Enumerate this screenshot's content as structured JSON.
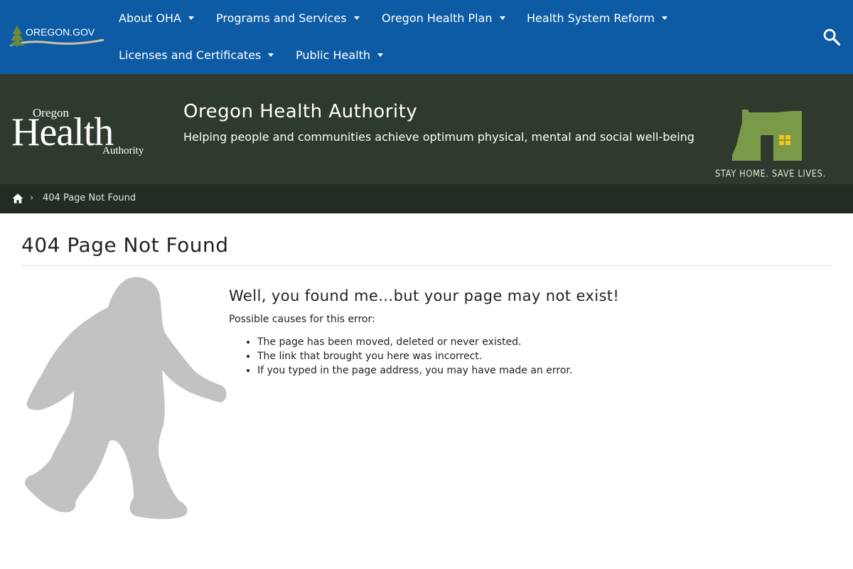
{
  "topnav": {
    "gov_logo_text": "OREGON.GOV",
    "items": [
      {
        "label": "About OHA"
      },
      {
        "label": "Programs and Services"
      },
      {
        "label": "Oregon Health Plan"
      },
      {
        "label": "Health System Reform"
      },
      {
        "label": "Licenses and Certificates"
      },
      {
        "label": "Public Health"
      }
    ],
    "search_icon": "search-icon"
  },
  "banner": {
    "logo_text_small_top": "Oregon",
    "logo_text_big": "Health",
    "logo_text_small_bottom": "Authority",
    "title": "Oregon Health Authority",
    "tagline": "Helping people and communities achieve optimum physical, mental and social well-being",
    "campaign_text": "STAY HOME. SAVE LIVES."
  },
  "breadcrumb": {
    "home_icon": "home-icon",
    "separator_icon": "chevron-right-icon",
    "current": "404 Page Not Found"
  },
  "main": {
    "page_title": "404 Page Not Found",
    "heading": "Well, you found me…but your page may not exist!",
    "causes_label": "Possible causes for this error:",
    "causes": [
      "The page has been moved, deleted or never existed.",
      "The link that brought you here was incorrect.",
      "If you typed in the page address, you may have made an error."
    ],
    "illustration": "bigfoot-silhouette"
  },
  "colors": {
    "nav_blue": "#0e5ba5",
    "banner_green": "#2e3a2e",
    "breadcrumb_dark": "#222c22",
    "campaign_green": "#7a9a4a",
    "campaign_window": "#f5c518",
    "bigfoot_gray": "#c4c1c3"
  }
}
